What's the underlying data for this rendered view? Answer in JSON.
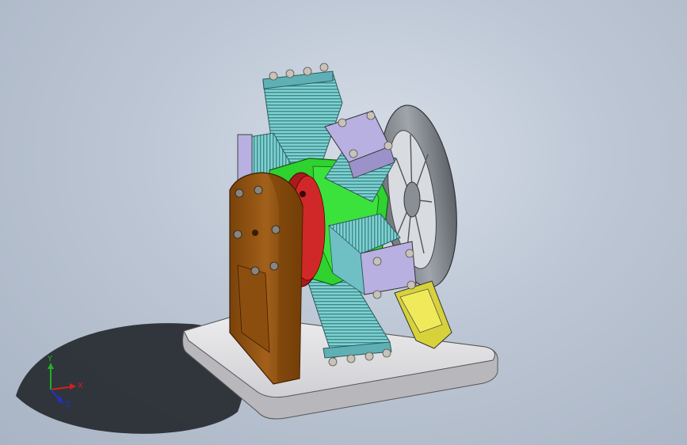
{
  "viewport": {
    "background_top": "#d6dde8",
    "background_bottom": "#a9b4c4"
  },
  "model": {
    "description_icon": "radial-engine-model",
    "colors": {
      "base_plate": "#e6e6e8",
      "left_support": "#9c5a12",
      "right_support": "#e8e24a",
      "crankcase": "#2fd22f",
      "front_hub": "#d02828",
      "cylinder_fins": "#7fd0d0",
      "cylinder_heads": "#b8b0e0",
      "flywheel": "#8a8f96",
      "bolts": "#c8c2b8"
    }
  },
  "triad": {
    "x_label": "X",
    "y_label": "Y",
    "z_label": "Z",
    "x_color": "#d02020",
    "y_color": "#20b020",
    "z_color": "#2030d0"
  }
}
